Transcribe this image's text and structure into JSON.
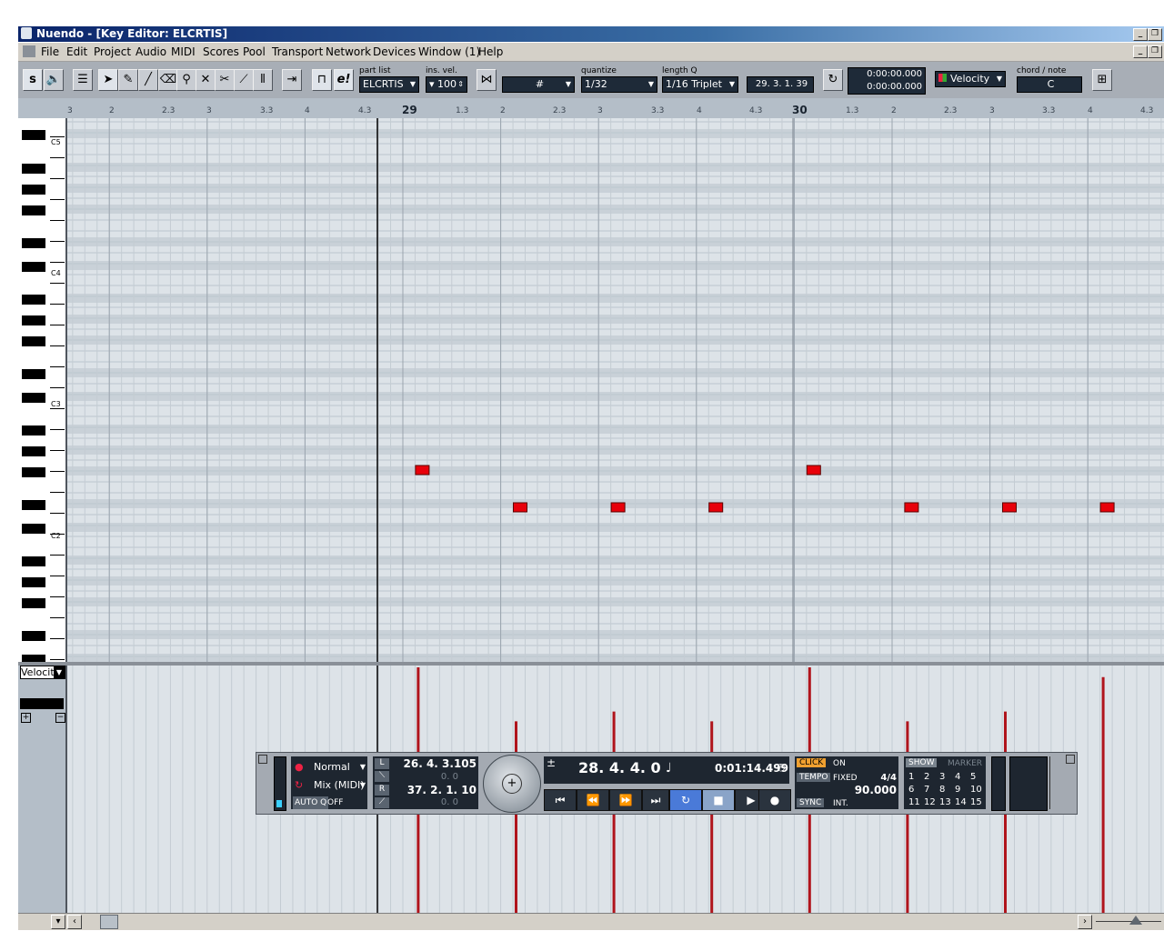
{
  "window": {
    "title": "Nuendo - [Key Editor: ELCRTIS]"
  },
  "menu": [
    "File",
    "Edit",
    "Project",
    "Audio",
    "MIDI",
    "Scores",
    "Pool",
    "Transport",
    "Network",
    "Devices",
    "Window (1)",
    "Help"
  ],
  "toolbar": {
    "part_list_label": "part list",
    "part_list_value": "ELCRTIS",
    "ins_vel_label": "ins. vel.",
    "ins_vel_value": "100",
    "quantize_label": "quantize",
    "quantize_value": "1/32",
    "length_q_label": "length Q",
    "length_q_value": "1/16 Triplet",
    "position_value": "29. 3. 1. 39",
    "time_top": "0:00:00.000",
    "time_bottom": "0:00:00.000",
    "controller_value": "Velocity",
    "chord_label": "chord / note",
    "chord_value": "C"
  },
  "ruler": {
    "labels": [
      "3",
      "2",
      "2.3",
      "3",
      "3.3",
      "4",
      "4.3",
      "1.3",
      "2",
      "2.3",
      "3",
      "3.3",
      "4",
      "4.3",
      "1.3",
      "2",
      "2.3",
      "3",
      "3.3",
      "4",
      "4.3"
    ],
    "bars": [
      "29",
      "30"
    ]
  },
  "keyboard": {
    "notes": [
      "C5",
      "C4",
      "C3",
      "C2"
    ]
  },
  "velocity_lane": {
    "selector": "Velocit"
  },
  "notes": [
    {
      "beat": 0.25,
      "row": "upper",
      "velocity": 100
    },
    {
      "beat": 1.25,
      "row": "lower",
      "velocity": 78
    },
    {
      "beat": 2.25,
      "row": "lower",
      "velocity": 82
    },
    {
      "beat": 3.25,
      "row": "lower",
      "velocity": 78
    },
    {
      "beat": 4.25,
      "row": "upper",
      "velocity": 100
    },
    {
      "beat": 5.25,
      "row": "lower",
      "velocity": 78
    },
    {
      "beat": 6.25,
      "row": "lower",
      "velocity": 82
    },
    {
      "beat": 7.25,
      "row": "lower",
      "velocity": 96
    }
  ],
  "transport": {
    "mode": "Normal",
    "mix": "Mix (MIDI)",
    "auto_q": "AUTO Q",
    "auto_q_state": "OFF",
    "left_locator": "26. 4. 3.105",
    "left_sub": "0.   0",
    "right_locator": "37. 2. 1. 10",
    "right_sub": "0.   0",
    "position": "28. 4. 4.   0",
    "time": "0:01:14.499",
    "click_label": "CLICK",
    "click_state": "ON",
    "tempo_label": "TEMPO",
    "tempo_mode": "FIXED",
    "signature": "4/4",
    "tempo": "90.000",
    "sync_label": "SYNC",
    "sync_state": "INT.",
    "show_label": "SHOW",
    "marker_label": "MARKER",
    "markers": [
      "1",
      "2",
      "3",
      "4",
      "5",
      "6",
      "7",
      "8",
      "9",
      "10",
      "11",
      "12",
      "13",
      "14",
      "15"
    ]
  }
}
